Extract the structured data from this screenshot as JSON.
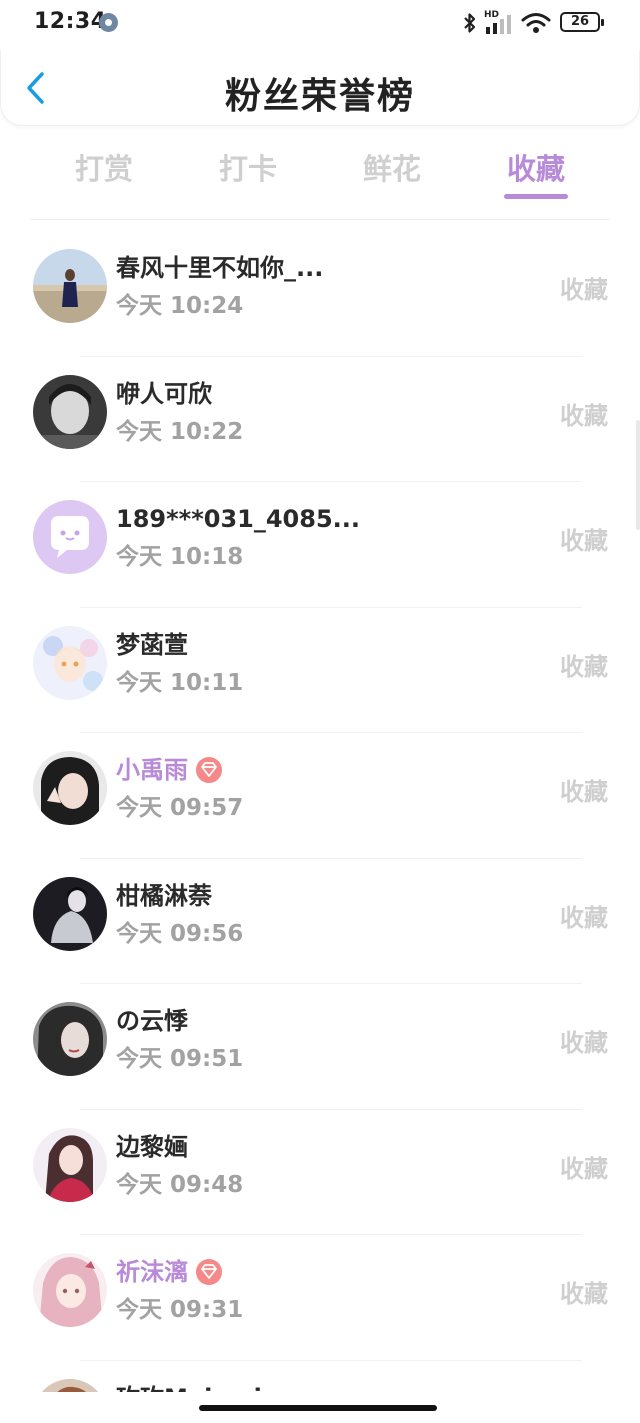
{
  "status_bar": {
    "time": "12:34",
    "battery": "26",
    "network_label": "HD"
  },
  "header": {
    "title": "粉丝荣誉榜"
  },
  "tabs": [
    {
      "label": "打赏"
    },
    {
      "label": "打卡"
    },
    {
      "label": "鲜花"
    },
    {
      "label": "收藏"
    }
  ],
  "active_tab": "收藏",
  "colors": {
    "accent": "#b88ad8",
    "vip_badge": "#f58888",
    "back_icon": "#1a9de0"
  },
  "fans": [
    {
      "name": "春风十里不如你_...",
      "time": "今天 10:24",
      "action": "收藏"
    },
    {
      "name": "咿人可欣",
      "time": "今天 10:22",
      "action": "收藏"
    },
    {
      "name": "189***031_4085...",
      "time": "今天 10:18",
      "action": "收藏"
    },
    {
      "name": "梦菡萱",
      "time": "今天 10:11",
      "action": "收藏"
    },
    {
      "name": "小禹雨",
      "time": "今天 09:57",
      "action": "收藏"
    },
    {
      "name": "柑橘淋萘",
      "time": "今天 09:56",
      "action": "收藏"
    },
    {
      "name": "の云悸",
      "time": "今天 09:51",
      "action": "收藏"
    },
    {
      "name": "边黎婳",
      "time": "今天 09:48",
      "action": "收藏"
    },
    {
      "name": "祈沫漓",
      "time": "今天 09:31",
      "action": "收藏"
    },
    {
      "name": "玫玫Meimeio",
      "time": "",
      "action": ""
    }
  ]
}
